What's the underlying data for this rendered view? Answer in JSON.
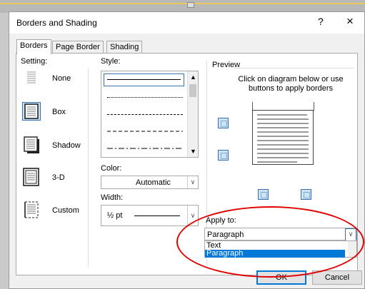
{
  "dialog": {
    "title": "Borders and Shading",
    "help": "?",
    "close": "×"
  },
  "tabs": [
    {
      "label": "Borders",
      "active": true
    },
    {
      "label": "Page Border",
      "active": false
    },
    {
      "label": "Shading",
      "active": false
    }
  ],
  "setting": {
    "label": "Setting:",
    "items": [
      {
        "label": "None",
        "icon": "border-none-icon",
        "selected": false
      },
      {
        "label": "Box",
        "icon": "border-box-icon",
        "selected": true
      },
      {
        "label": "Shadow",
        "icon": "border-shadow-icon",
        "selected": false
      },
      {
        "label": "3-D",
        "icon": "border-3d-icon",
        "selected": false
      },
      {
        "label": "Custom",
        "icon": "border-custom-icon",
        "selected": false
      }
    ]
  },
  "style": {
    "label": "Style:",
    "options": [
      "solid",
      "dotted",
      "dashed-small",
      "dashed",
      "dash-dot"
    ],
    "selected": "solid"
  },
  "color": {
    "label": "Color:",
    "value": "Automatic"
  },
  "width": {
    "label": "Width:",
    "value": "½ pt",
    "line": "solid"
  },
  "preview": {
    "label": "Preview",
    "hint": "Click on diagram below or use buttons to apply borders",
    "buttons": [
      "top-border-icon",
      "bottom-border-icon",
      "left-border-icon",
      "right-border-icon"
    ]
  },
  "apply_to": {
    "label": "Apply to:",
    "value": "Paragraph",
    "options": [
      "Text",
      "Paragraph"
    ],
    "selected": "Paragraph"
  },
  "footer": {
    "ok": "OK",
    "cancel": "Cancel"
  },
  "colors": {
    "accent": "#0078d7",
    "selected_bg": "#cce4f7",
    "annotation": "#e00000"
  }
}
